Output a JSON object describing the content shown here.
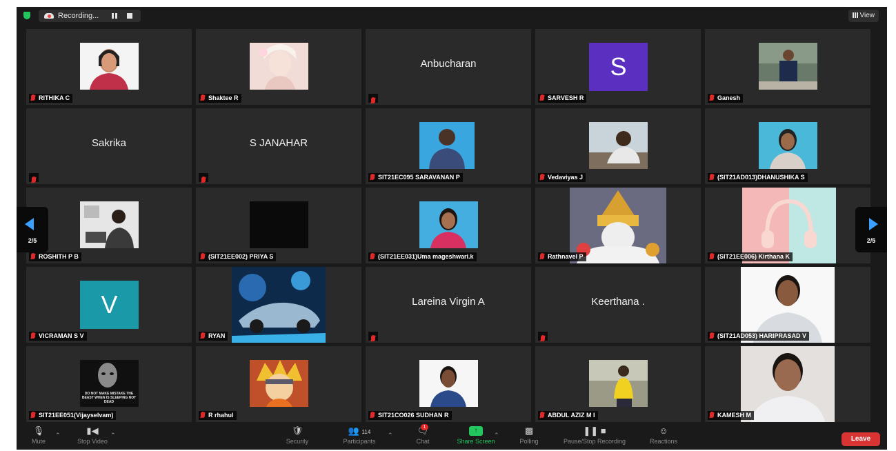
{
  "topbar": {
    "recording_label": "Recording...",
    "view_label": "View"
  },
  "pagination": {
    "page_left": "2/5",
    "page_right": "2/5"
  },
  "participants": [
    {
      "label": "RITHIKA C"
    },
    {
      "label": "Shaktee R"
    },
    {
      "label": "",
      "name": "Anbucharan"
    },
    {
      "label": "SARVESH R",
      "avatar_letter": "S",
      "avatar_color": "#5b2fc0"
    },
    {
      "label": "Ganesh"
    },
    {
      "label": "",
      "name": "Sakrika"
    },
    {
      "label": "",
      "name": "S JANAHAR"
    },
    {
      "label": "SIT21EC095 SARAVANAN P"
    },
    {
      "label": "Vedaviyas J"
    },
    {
      "label": "(SIT21AD013)DHANUSHIKA S"
    },
    {
      "label": "ROSHITH P B"
    },
    {
      "label": "(SIT21EE002) PRIYA S"
    },
    {
      "label": "(SIT21EE031)Uma mageshwari.k"
    },
    {
      "label": "Rathnavel P"
    },
    {
      "label": "(SIT21EE006) Kirthana K"
    },
    {
      "label": "VICRAMAN S V",
      "avatar_letter": "V",
      "avatar_color": "#1a9aa8"
    },
    {
      "label": "RYAN"
    },
    {
      "label": "",
      "name": "Lareina Virgin A"
    },
    {
      "label": "",
      "name": "Keerthana ."
    },
    {
      "label": "(SIT21AD053) HARIPRASAD V"
    },
    {
      "label": "SIT21EE051(Vijayselvam)",
      "photo_caption": "DO NOT MAKE MISTAKE THE BEAST WHEN IS SLEEPING NOT DEAD"
    },
    {
      "label": "R rhahul"
    },
    {
      "label": "SIT21CO026 SUDHAN R"
    },
    {
      "label": "ABDUL AZIZ M I"
    },
    {
      "label": "KAMESH M"
    }
  ],
  "toolbar": {
    "mute": "Mute",
    "stop_video": "Stop Video",
    "security": "Security",
    "participants": "Participants",
    "participants_count": "114",
    "chat": "Chat",
    "chat_badge": "1",
    "share_screen": "Share Screen",
    "polling": "Polling",
    "pause_stop_recording": "Pause/Stop Recording",
    "reactions": "Reactions",
    "leave": "Leave"
  },
  "colors": {
    "window_bg": "#1a1a1a",
    "tile_bg": "#2a2a2a",
    "muted_mic": "#e02828",
    "share_green": "#22c55e",
    "leave_red": "#d93434",
    "nav_arrow": "#3aa0ff"
  }
}
